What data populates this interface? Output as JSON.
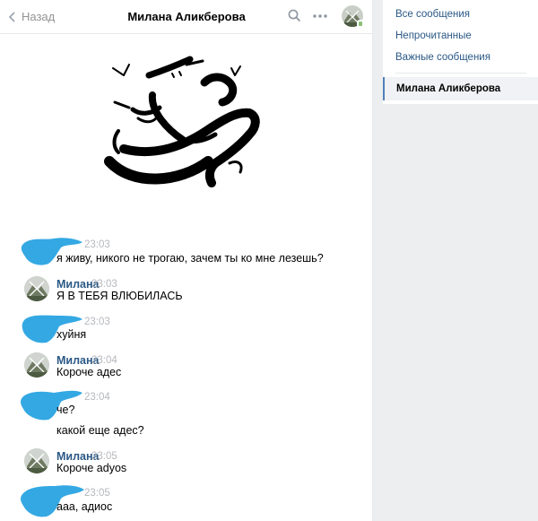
{
  "header": {
    "back_label": "Назад",
    "title": "Милана Аликберова"
  },
  "messages": [
    {
      "time": "23:03",
      "text": "я живу, никого не трогаю, зачем ты ко мне лезешь?"
    },
    {
      "author": "Милана",
      "time": "23:03",
      "text": "Я В ТЕБЯ ВЛЮБИЛАСЬ"
    },
    {
      "time": "23:03",
      "text": "хуйня"
    },
    {
      "author": "Милана",
      "time": "23:04",
      "text": "Короче адес"
    },
    {
      "time": "23:04",
      "text": "че?",
      "text2": "какой еще адес?"
    },
    {
      "author": "Милана",
      "time": "23:05",
      "text": "Короче adyos"
    },
    {
      "time": "23:05",
      "text": "ааа, адиос"
    }
  ],
  "sidebar": {
    "items": [
      "Все сообщения",
      "Непрочитанные",
      "Важные сообщения"
    ],
    "active": "Милана Аликберова"
  },
  "colors": {
    "link": "#2a5885",
    "redaction": "#1e9ee0",
    "accent": "#5181b8",
    "online": "#8ac176"
  },
  "icons": [
    "chevron-left-icon",
    "search-icon",
    "more-icon"
  ]
}
